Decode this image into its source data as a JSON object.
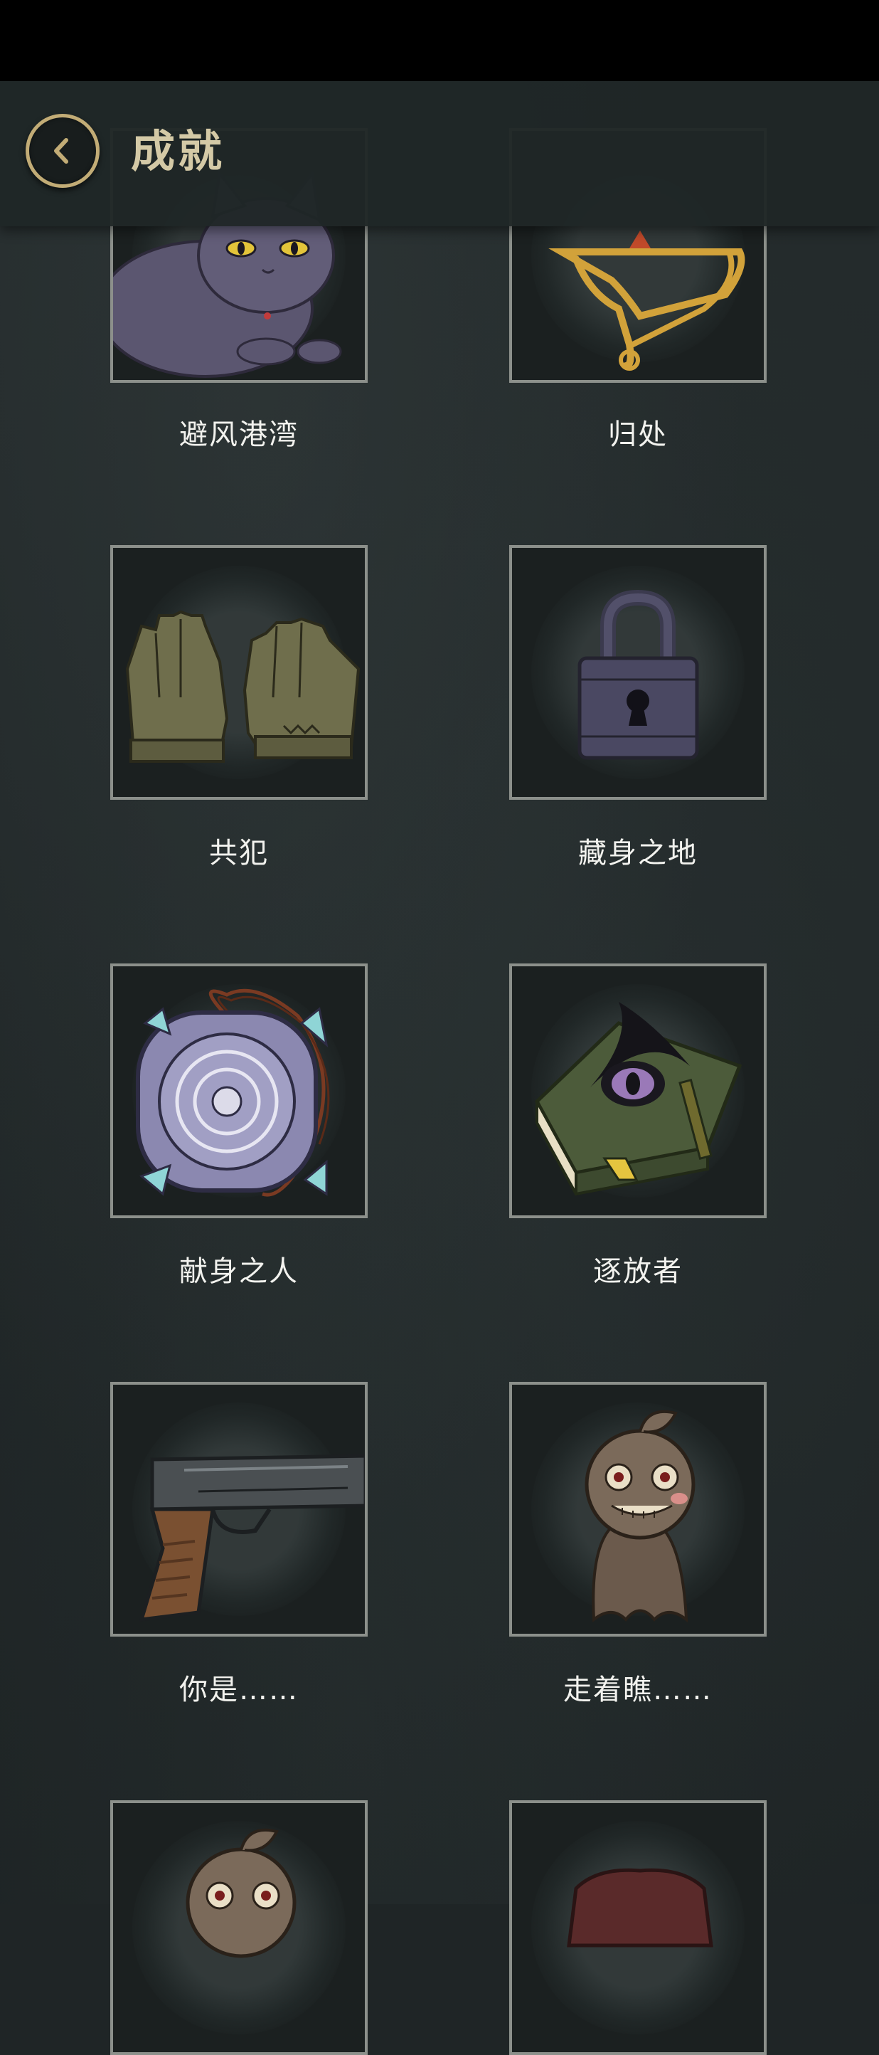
{
  "header": {
    "title": "成就"
  },
  "colors": {
    "accent": "#c2ac76",
    "title": "#d4c9a6",
    "background": "#1f2526",
    "card_border": "#8c908b"
  },
  "achievements": [
    {
      "label": "避风港湾",
      "icon": "cat-icon"
    },
    {
      "label": "归处",
      "icon": "golden-heart-frame-icon"
    },
    {
      "label": "共犯",
      "icon": "gloves-icon"
    },
    {
      "label": "藏身之地",
      "icon": "padlock-icon"
    },
    {
      "label": "献身之人",
      "icon": "maze-amulet-icon"
    },
    {
      "label": "逐放者",
      "icon": "eye-book-icon"
    },
    {
      "label": "你是……",
      "icon": "pistol-icon"
    },
    {
      "label": "走着瞧……",
      "icon": "voodoo-doll-icon"
    },
    {
      "label": "",
      "icon": "voodoo-doll-icon"
    },
    {
      "label": "",
      "icon": "red-cloth-icon"
    }
  ]
}
